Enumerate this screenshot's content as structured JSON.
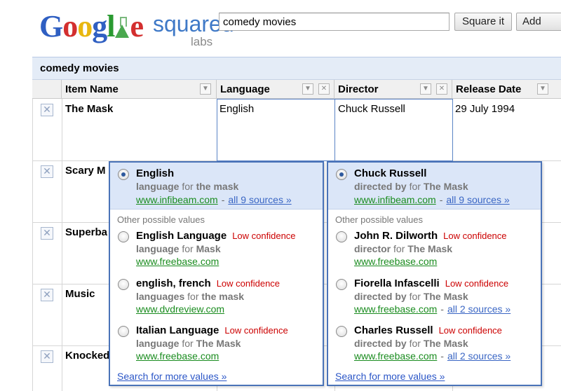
{
  "header": {
    "logo": {
      "google": "Google",
      "product": "squared",
      "sub": "labs"
    },
    "search_value": "comedy movies",
    "square_button": "Square it",
    "add_button": "Add"
  },
  "table": {
    "title": "comedy movies",
    "columns": [
      "Item Name",
      "Language",
      "Director",
      "Release Date"
    ],
    "rows": [
      {
        "name": "The Mask",
        "language": "English",
        "director": "Chuck Russell",
        "release_date": "29 July 1994"
      },
      {
        "name": "Scary M"
      },
      {
        "name": "Superba"
      },
      {
        "name": "Music"
      },
      {
        "name": "Knocked"
      }
    ]
  },
  "language_popup": {
    "selected": {
      "value": "English",
      "desc_prefix": "language",
      "desc_mid": "for",
      "desc_subject": "the mask",
      "source": "www.infibeam.com",
      "more": "all 9 sources »"
    },
    "other_label": "Other possible values",
    "options": [
      {
        "value": "English Language",
        "confidence": "Low confidence",
        "desc_prefix": "language",
        "desc_mid": "for",
        "desc_subject": "Mask",
        "source": "www.freebase.com"
      },
      {
        "value": "english, french",
        "confidence": "Low confidence",
        "desc_prefix": "languages",
        "desc_mid": "for",
        "desc_subject": "the mask",
        "source": "www.dvdreview.com"
      },
      {
        "value": "Italian Language",
        "confidence": "Low confidence",
        "desc_prefix": "language",
        "desc_mid": "for",
        "desc_subject": "The Mask",
        "source": "www.freebase.com"
      }
    ],
    "search_more": "Search for more values »"
  },
  "director_popup": {
    "selected": {
      "value": "Chuck Russell",
      "desc_prefix": "directed by",
      "desc_mid": "for",
      "desc_subject": "The Mask",
      "source": "www.infibeam.com",
      "more": "all 9 sources »"
    },
    "other_label": "Other possible values",
    "options": [
      {
        "value": "John R. Dilworth",
        "confidence": "Low confidence",
        "desc_prefix": "director",
        "desc_mid": "for",
        "desc_subject": "The Mask",
        "source": "www.freebase.com"
      },
      {
        "value": "Fiorella Infascelli",
        "confidence": "Low confidence",
        "desc_prefix": "directed by",
        "desc_mid": "for",
        "desc_subject": "The Mask",
        "source": "www.freebase.com",
        "more": "all 2 sources »"
      },
      {
        "value": "Charles Russell",
        "confidence": "Low confidence",
        "desc_prefix": "directed by",
        "desc_mid": "for",
        "desc_subject": "The Mask",
        "source": "www.freebase.com",
        "more": "all 2 sources »"
      }
    ],
    "search_more": "Search for more values »"
  },
  "colors": {
    "accent": "#4a73b8",
    "selected_bg": "#dbe6f8",
    "low_confidence": "#cc0000",
    "source_link": "#1a8c1f",
    "link": "#2b56c7"
  }
}
